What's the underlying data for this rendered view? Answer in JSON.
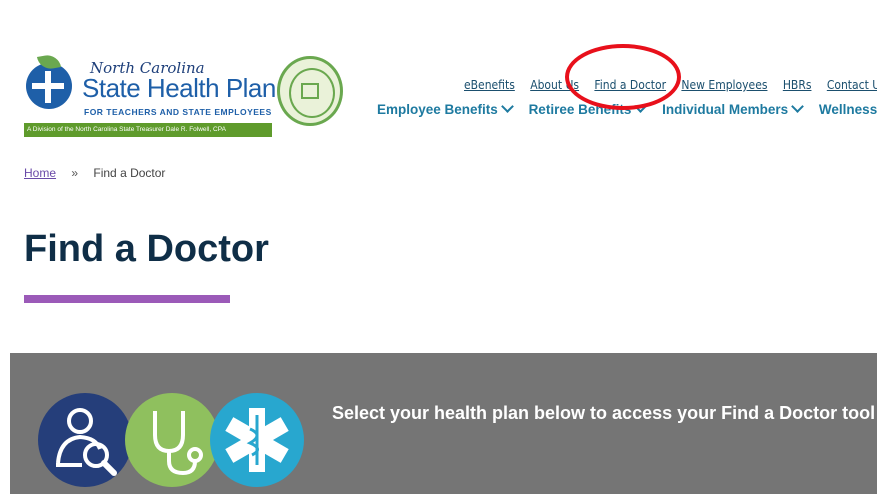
{
  "logo": {
    "region": "North Carolina",
    "name": "State Health Plan",
    "tagline": "FOR TEACHERS AND STATE EMPLOYEES",
    "division": "A Division of the North Carolina State Treasurer Dale R. Folwell, CPA"
  },
  "utility_nav": [
    "eBenefits",
    "About Us",
    "Find a Doctor",
    "New Employees",
    "HBRs",
    "Contact Us"
  ],
  "main_nav": [
    "Employee Benefits",
    "Retiree Benefits",
    "Individual Members",
    "Wellness"
  ],
  "breadcrumb": {
    "home": "Home",
    "separator": "»",
    "current": "Find a Doctor"
  },
  "page_title": "Find a Doctor",
  "banner": {
    "text": "Select your health plan below to access your Find a Doctor tool"
  },
  "colors": {
    "annotation": "#e8101b",
    "accent": "#9b5ab8",
    "nav": "#1e7aa0",
    "banner": "#757575"
  },
  "icons": [
    "doctor-search-icon",
    "stethoscope-icon",
    "star-of-life-icon"
  ]
}
